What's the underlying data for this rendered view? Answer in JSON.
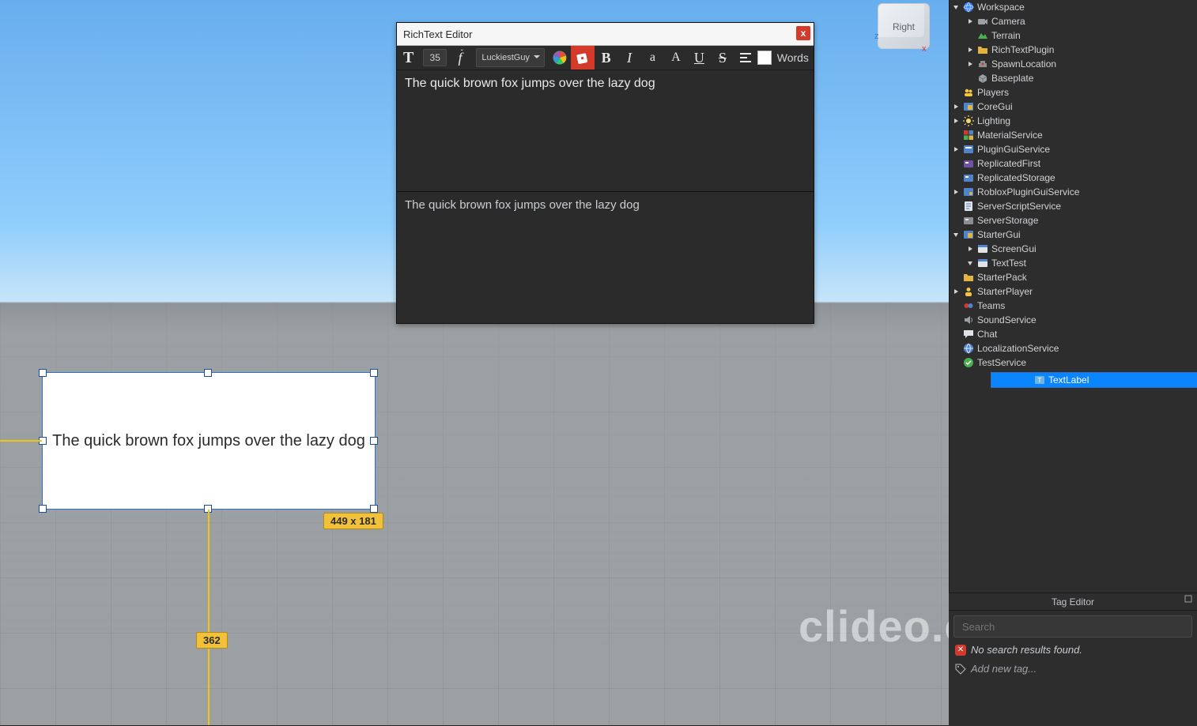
{
  "viewport": {
    "orientCube": "Right",
    "axisX": "x",
    "axisZ": "z",
    "selectedLabelText": "The quick brown fox jumps over the lazy dog",
    "sizeTag": "449 x 181",
    "yOffsetTag": "362"
  },
  "richTextEditor": {
    "title": "RichText Editor",
    "close": "x",
    "fontSize": "35",
    "fontName": "LuckiestGuy",
    "wordsLabel": "Words",
    "buttons": {
      "textSize": "T",
      "kerning": "f",
      "bold": "B",
      "italic": "I",
      "lowercase": "a",
      "uppercase": "A",
      "underline": "U",
      "strike": "S"
    },
    "editorText": "The quick brown fox jumps over the lazy dog",
    "sourceText": "The quick brown fox jumps over the lazy dog"
  },
  "explorer": {
    "tree": [
      {
        "d": 0,
        "exp": "open",
        "icon": "globe",
        "label": "Workspace"
      },
      {
        "d": 1,
        "exp": "closed",
        "icon": "camera",
        "label": "Camera"
      },
      {
        "d": 1,
        "exp": "none",
        "icon": "terrain",
        "label": "Terrain"
      },
      {
        "d": 1,
        "exp": "closed",
        "icon": "folder",
        "label": "RichTextPlugin"
      },
      {
        "d": 1,
        "exp": "closed",
        "icon": "spawn",
        "label": "SpawnLocation"
      },
      {
        "d": 1,
        "exp": "none",
        "icon": "part",
        "label": "Baseplate"
      },
      {
        "d": 0,
        "exp": "none",
        "icon": "players",
        "label": "Players"
      },
      {
        "d": 0,
        "exp": "closed",
        "icon": "coregui",
        "label": "CoreGui"
      },
      {
        "d": 0,
        "exp": "closed",
        "icon": "lighting",
        "label": "Lighting"
      },
      {
        "d": 0,
        "exp": "none",
        "icon": "material",
        "label": "MaterialService"
      },
      {
        "d": 0,
        "exp": "closed",
        "icon": "plugingui",
        "label": "PluginGuiService"
      },
      {
        "d": 0,
        "exp": "none",
        "icon": "repfirst",
        "label": "ReplicatedFirst"
      },
      {
        "d": 0,
        "exp": "none",
        "icon": "repstore",
        "label": "ReplicatedStorage"
      },
      {
        "d": 0,
        "exp": "closed",
        "icon": "rbxplugin",
        "label": "RobloxPluginGuiService"
      },
      {
        "d": 0,
        "exp": "none",
        "icon": "script",
        "label": "ServerScriptService"
      },
      {
        "d": 0,
        "exp": "none",
        "icon": "storage",
        "label": "ServerStorage"
      },
      {
        "d": 0,
        "exp": "open",
        "icon": "gui",
        "label": "StarterGui"
      },
      {
        "d": 1,
        "exp": "closed",
        "icon": "screengui",
        "label": "ScreenGui"
      },
      {
        "d": 1,
        "exp": "open",
        "icon": "screengui",
        "label": "TextTest"
      },
      {
        "d": 2,
        "exp": "none",
        "icon": "textlabel",
        "label": "TextLabel",
        "selected": true
      },
      {
        "d": 0,
        "exp": "none",
        "icon": "folder",
        "label": "StarterPack"
      },
      {
        "d": 0,
        "exp": "closed",
        "icon": "player",
        "label": "StarterPlayer"
      },
      {
        "d": 0,
        "exp": "none",
        "icon": "teams",
        "label": "Teams"
      },
      {
        "d": 0,
        "exp": "none",
        "icon": "sound",
        "label": "SoundService"
      },
      {
        "d": 0,
        "exp": "none",
        "icon": "chat",
        "label": "Chat"
      },
      {
        "d": 0,
        "exp": "none",
        "icon": "loc",
        "label": "LocalizationService"
      },
      {
        "d": 0,
        "exp": "none",
        "icon": "test",
        "label": "TestService"
      }
    ]
  },
  "tagEditor": {
    "title": "Tag Editor",
    "searchPlaceholder": "Search",
    "noResults": "No search results found.",
    "addNew": "Add new tag..."
  },
  "watermark": "clideo.com"
}
